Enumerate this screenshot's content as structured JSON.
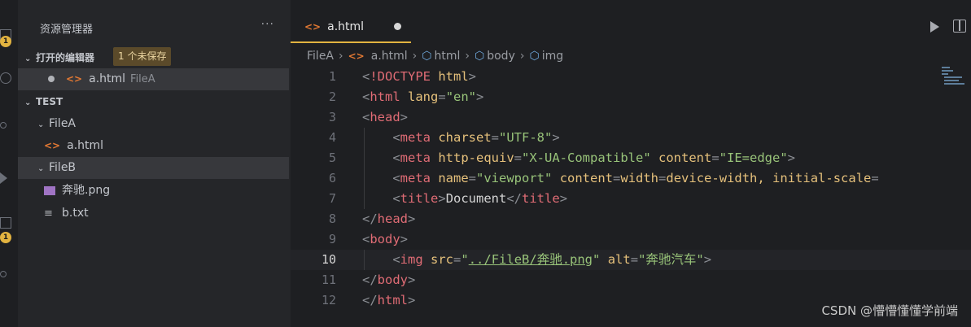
{
  "activity_bar": {
    "badges": [
      "1",
      "1"
    ]
  },
  "sidebar": {
    "title": "资源管理器",
    "more": "···",
    "open_editors": {
      "label": "打开的编辑器",
      "unsaved_badge": "1 个未保存",
      "items": [
        {
          "name": "a.html",
          "folder": "FileA"
        }
      ]
    },
    "workspace": {
      "label": "TEST",
      "folders": [
        {
          "name": "FileA",
          "files": [
            {
              "name": "a.html",
              "icon": "html-icon"
            }
          ]
        },
        {
          "name": "FileB",
          "files": [
            {
              "name": "奔驰.png",
              "icon": "image-icon"
            },
            {
              "name": "b.txt",
              "icon": "text-file-icon"
            }
          ]
        }
      ]
    }
  },
  "editor": {
    "tab": {
      "label": "a.html"
    },
    "breadcrumb": [
      "FileA",
      "a.html",
      "html",
      "body",
      "img"
    ],
    "line_numbers": [
      "1",
      "2",
      "3",
      "4",
      "5",
      "6",
      "7",
      "8",
      "9",
      "10",
      "11",
      "12"
    ],
    "code_lines": [
      "<!DOCTYPE html>",
      "<html lang=\"en\">",
      "<head>",
      "    <meta charset=\"UTF-8\">",
      "    <meta http-equiv=\"X-UA-Compatible\" content=\"IE=edge\">",
      "    <meta name=\"viewport\" content=\"width=device-width, initial-scale=",
      "    <title>Document</title>",
      "</head>",
      "<body>",
      "    <img src=\"../FileB/奔驰.png\" alt=\"奔驰汽车\">",
      "</body>",
      "</html>"
    ],
    "current_line": "10"
  },
  "colors": {
    "accent": "#e2b340",
    "tag": "#e06c75",
    "attribute": "#e5c07b",
    "string": "#98c379"
  },
  "watermark": "CSDN @懵懵懂懂学前端"
}
